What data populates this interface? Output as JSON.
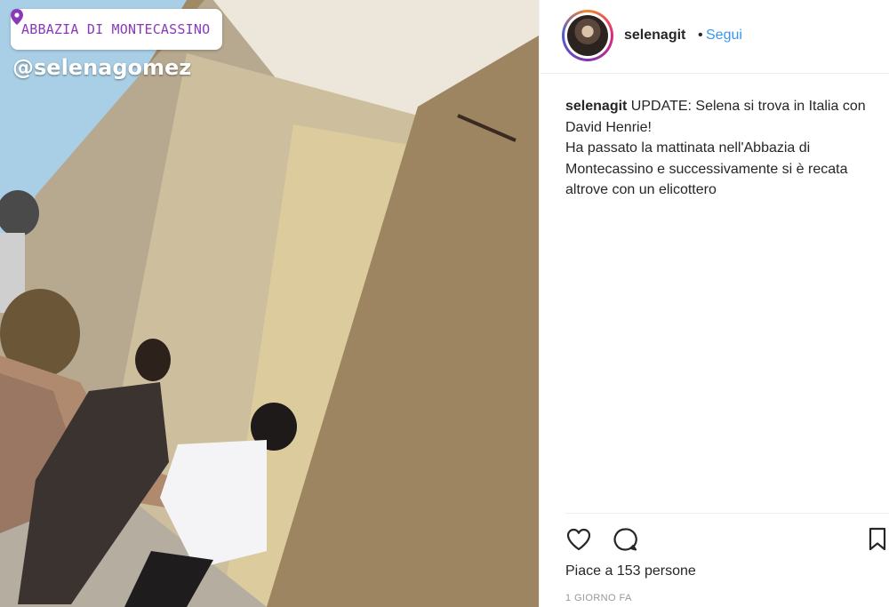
{
  "photo": {
    "location": "ABBAZIA DI MONTECASSINO",
    "mention": "@selenagomez"
  },
  "header": {
    "username": "selenagit",
    "separator": "•",
    "follow_label": "Segui"
  },
  "caption": {
    "username": "selenagit",
    "line1": " UPDATE: Selena si trova in Italia con",
    "line2": "David Henrie!",
    "line3": "Ha passato la mattinata nell'Abbazia di",
    "line4": "Montecassino e successivamente si è recata",
    "line5": "altrove con un elicottero"
  },
  "actions": {
    "likes": "Piace a 153 persone",
    "time": "1 GIORNO FA"
  },
  "colors": {
    "accent": "#3897f0",
    "location_text": "#8a3ab9"
  }
}
